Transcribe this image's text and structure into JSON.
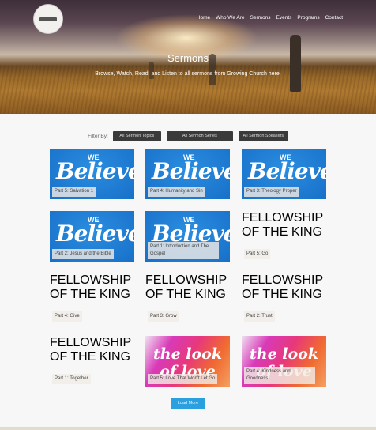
{
  "nav": {
    "items": [
      "Home",
      "Who We Are",
      "Sermons",
      "Events",
      "Programs",
      "Contact"
    ]
  },
  "hero": {
    "title": "Sermons",
    "subtitle": "Browse, Watch, Read, and Listen to all sermons from Growing Church here."
  },
  "filter": {
    "label": "Filter By:",
    "topics": "All Sermon Topics",
    "series": "All Sermon Series",
    "speakers": "All Sermon Speakers"
  },
  "sermons": [
    {
      "title": "Part 5: Salvation 1",
      "series": "believe"
    },
    {
      "title": "Part 4: Humanity and Sin",
      "series": "believe"
    },
    {
      "title": "Part 3: Theology Proper",
      "series": "believe"
    },
    {
      "title": "Part 2: Jesus and the Bible",
      "series": "believe"
    },
    {
      "title": "Part 1: Introduction and The Gospel",
      "series": "believe"
    },
    {
      "title": "Part 5: Go",
      "series": "fellowship"
    },
    {
      "title": "Part 4: Give",
      "series": "fellowship"
    },
    {
      "title": "Part 3: Grow",
      "series": "fellowship"
    },
    {
      "title": "Part 2: Trust",
      "series": "fellowship"
    },
    {
      "title": "Part 1: Together",
      "series": "fellowship"
    },
    {
      "title": "Part 5: Love That Won't Let Go",
      "series": "love"
    },
    {
      "title": "Part 4: Kindness and Goodness",
      "series": "love"
    }
  ],
  "artwork": {
    "believe": [
      "WE",
      "Believe"
    ],
    "fellowship": [
      "FELLOWSHIP",
      "OF THE KING"
    ],
    "love": [
      "the look of love"
    ]
  },
  "load_more": "Load More",
  "colors": {
    "accent": "#2aa0e0",
    "filter_button": "#3a3a3a"
  }
}
